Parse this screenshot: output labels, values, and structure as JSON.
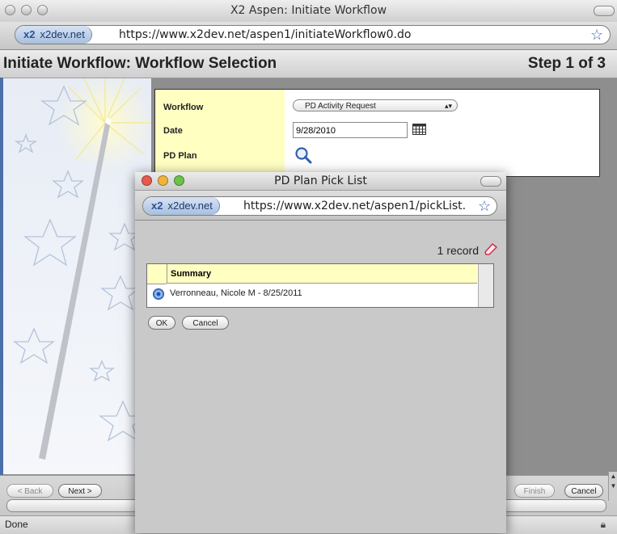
{
  "main_window": {
    "title": "X2 Aspen: Initiate Workflow",
    "site_badge": "x2",
    "site_name": "x2dev.net",
    "url": "https://www.x2dev.net/aspen1/initiateWorkflow0.do",
    "page_title": "Initiate Workflow: Workflow Selection",
    "step": "Step 1 of 3",
    "status": "Done"
  },
  "form": {
    "workflow_label": "Workflow",
    "workflow_value": "PD Activity Request",
    "date_label": "Date",
    "date_value": "9/28/2010",
    "plan_label": "PD Plan"
  },
  "bottom_buttons": {
    "back": "< Back",
    "next": "Next >",
    "finish": "Finish",
    "cancel": "Cancel"
  },
  "popup": {
    "title": "PD Plan Pick List",
    "site_badge": "x2",
    "site_name": "x2dev.net",
    "url": "https://www.x2dev.net/aspen1/pickList.",
    "record_count": "1 record",
    "column_header": "Summary",
    "rows": [
      {
        "summary": "Verronneau, Nicole M - 8/25/2011",
        "selected": true
      }
    ],
    "ok": "OK",
    "cancel": "Cancel"
  }
}
